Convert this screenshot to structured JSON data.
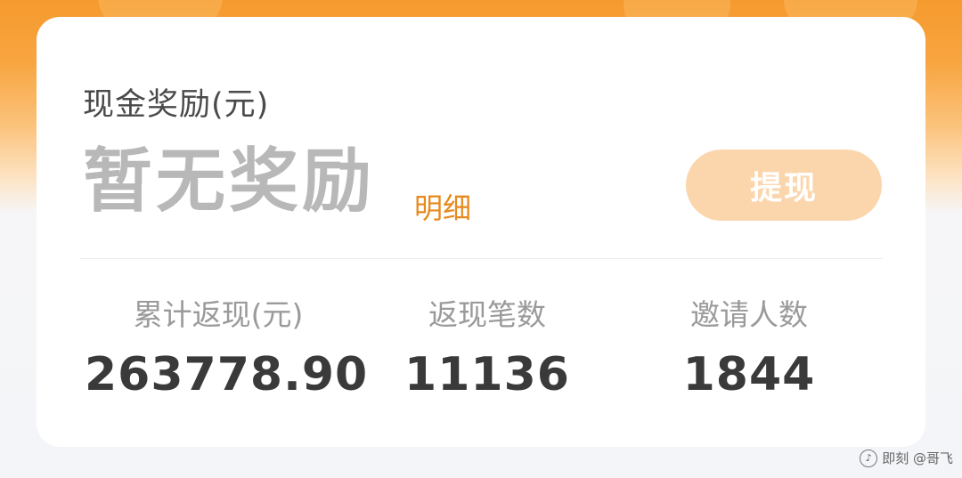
{
  "card": {
    "section_title": "现金奖励(元)",
    "reward_status": "暂无奖励",
    "detail_label": "明细",
    "withdraw_label": "提现"
  },
  "stats": [
    {
      "label": "累计返现(元)",
      "value": "263778.90"
    },
    {
      "label": "返现笔数",
      "value": "11136"
    },
    {
      "label": "邀请人数",
      "value": "1844"
    }
  ],
  "watermark": {
    "text": "即刻 @哥飞",
    "icon": "jike-logo-icon"
  },
  "colors": {
    "header_gradient_top": "#f59a2e",
    "accent_orange": "#e68a1e",
    "withdraw_button_bg": "#fbd6ad",
    "page_bg": "#f4f5f8"
  }
}
